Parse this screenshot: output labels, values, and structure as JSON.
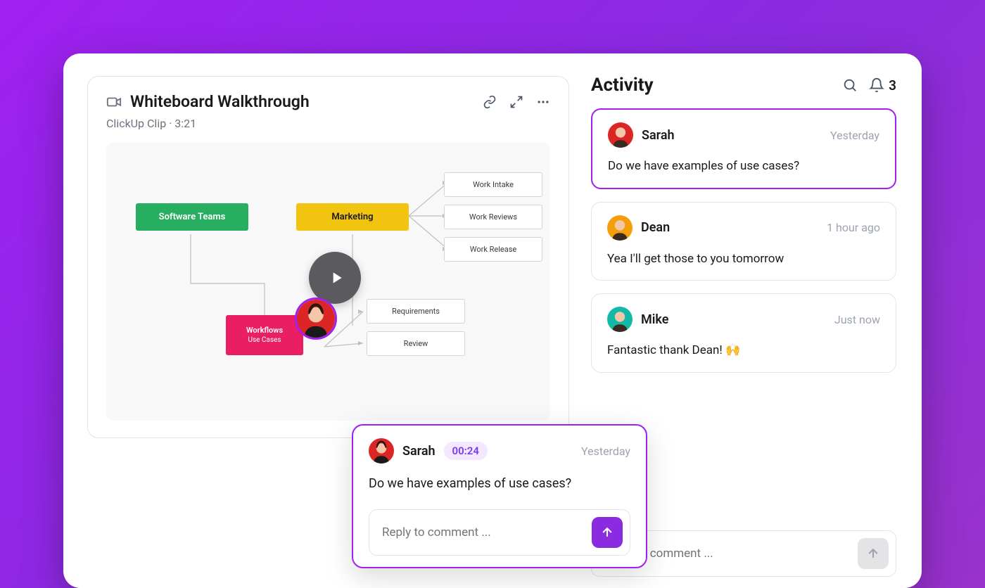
{
  "clip": {
    "title": "Whiteboard Walkthrough",
    "subtitle": "ClickUp Clip · 3:21"
  },
  "diagram": {
    "software_teams": "Software Teams",
    "marketing": "Marketing",
    "workflows_title": "Workflows",
    "workflows_sub": "Use Cases",
    "work_intake": "Work Intake",
    "work_reviews": "Work Reviews",
    "work_release": "Work Release",
    "requirements": "Requirements",
    "review": "Review"
  },
  "popup": {
    "author": "Sarah",
    "timestamp_badge": "00:24",
    "time_label": "Yesterday",
    "text": "Do we have examples of use cases?",
    "reply_placeholder": "Reply to comment ..."
  },
  "activity": {
    "title": "Activity",
    "notification_count": "3",
    "reply_placeholder": "Reply to comment ...",
    "comments": [
      {
        "author": "Sarah",
        "time": "Yesterday",
        "text": "Do we have examples of use cases?",
        "avatar_color": "#dc2626",
        "highlight": true
      },
      {
        "author": "Dean",
        "time": "1 hour ago",
        "text": "Yea I'll get those to you tomorrow",
        "avatar_color": "#f59e0b",
        "highlight": false
      },
      {
        "author": "Mike",
        "time": "Just now",
        "text": "Fantastic thank Dean! 🙌",
        "avatar_color": "#14b8a6",
        "highlight": false
      }
    ]
  },
  "avatars": {
    "sarah_color": "#dc2626",
    "dean_color": "#f59e0b",
    "mike_color": "#14b8a6"
  }
}
